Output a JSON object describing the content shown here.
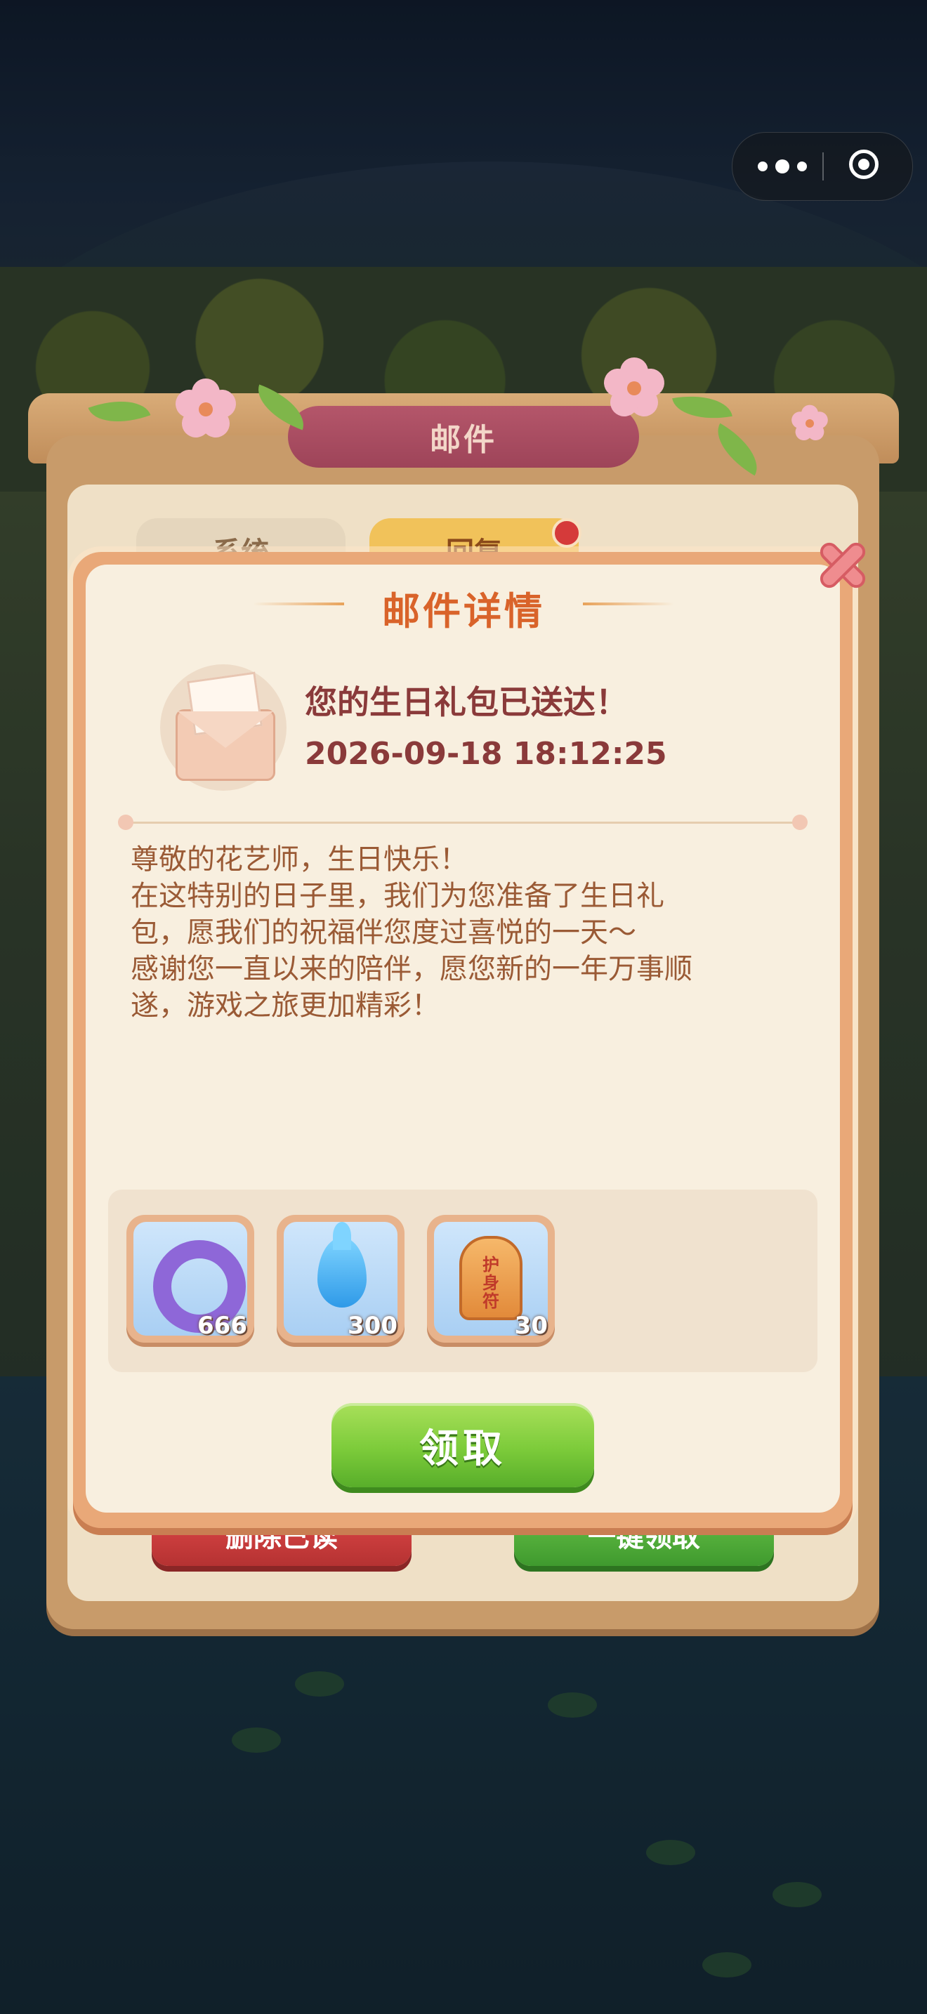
{
  "background_panel": {
    "title": "邮件",
    "tabs": [
      {
        "label": "系统"
      },
      {
        "label": "回复"
      }
    ],
    "buttons": {
      "delete_read": "删除已读",
      "claim_all": "一键领取"
    }
  },
  "capsule": {
    "more_icon": "more-dots-icon",
    "close_icon": "target-circle-icon"
  },
  "modal": {
    "title": "邮件详情",
    "close_icon": "close-x-icon",
    "mail": {
      "subject": "您的生日礼包已送达！",
      "date": "2026-09-18 18:12:25",
      "icon": "envelope-icon",
      "body_lines": [
        "尊敬的花艺师，生日快乐！",
        "在这特别的日子里，我们为您准备了生日礼",
        "包，愿我们的祝福伴您度过喜悦的一天～",
        "感谢您一直以来的陪伴，愿您新的一年万事顺",
        "遂，游戏之旅更加精彩！"
      ]
    },
    "rewards": [
      {
        "icon": "purple-ring-icon",
        "count": "666"
      },
      {
        "icon": "water-drop-icon",
        "count": "300"
      },
      {
        "icon": "charm-amulet-icon",
        "count": "30",
        "charm_text": "护身符"
      }
    ],
    "claim_button": "领取"
  },
  "colors": {
    "title_orange": "#d9632a",
    "subject_red": "#8a3a3a",
    "body_brown": "#9a5a35",
    "claim_green": "#7ccb3a"
  }
}
